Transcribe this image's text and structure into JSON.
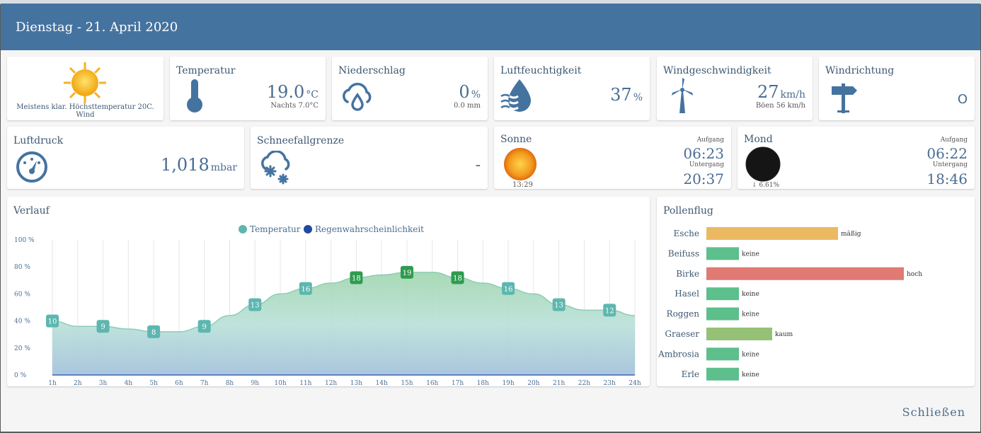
{
  "header": {
    "title": "Dienstag - 21. April 2020"
  },
  "summary": {
    "text": "Meistens klar. Höchsttemperatur 20C. Wind"
  },
  "temperature": {
    "title": "Temperatur",
    "value": "19.0",
    "unit": "°C",
    "night": "Nachts 7.0°C"
  },
  "precipitation": {
    "title": "Niederschlag",
    "value": "0",
    "unit": "%",
    "amount": "0.0 mm"
  },
  "humidity": {
    "title": "Luftfeuchtigkeit",
    "value": "37",
    "unit": "%"
  },
  "wind_speed": {
    "title": "Windgeschwindigkeit",
    "value": "27",
    "unit": "km/h",
    "gusts": "Böen 56 km/h"
  },
  "wind_direction": {
    "title": "Windrichtung",
    "value": "O"
  },
  "pressure": {
    "title": "Luftdruck",
    "value": "1,018",
    "unit": "mbar"
  },
  "snow_line": {
    "title": "Schneefallgrenze",
    "value": "-"
  },
  "sun": {
    "title": "Sonne",
    "rise_label": "Aufgang",
    "rise": "06:23",
    "set_label": "Untergang",
    "set": "20:37",
    "duration": "13:29"
  },
  "moon": {
    "title": "Mond",
    "rise_label": "Aufgang",
    "rise": "06:22",
    "set_label": "Untergang",
    "set": "18:46",
    "illumination": "6.61%"
  },
  "chart_section": {
    "title": "Verlauf"
  },
  "pollen_section": {
    "title": "Pollenflug"
  },
  "footer": {
    "close_label": "Schließen"
  },
  "colors": {
    "header": "#4573a0",
    "temp_area": "#8fc9c0",
    "rain_area": "#a8c6db",
    "green_label": "#2e9c4e",
    "teal_label": "#5db7b0",
    "pollen_moderate": "#ebb962",
    "pollen_none": "#5dbf8b",
    "pollen_high": "#e07a72",
    "pollen_low": "#95c177"
  },
  "chart_data": [
    {
      "type": "area",
      "title": "Verlauf",
      "x": [
        "1h",
        "2h",
        "3h",
        "4h",
        "5h",
        "6h",
        "7h",
        "8h",
        "9h",
        "10h",
        "11h",
        "12h",
        "13h",
        "14h",
        "15h",
        "16h",
        "17h",
        "18h",
        "19h",
        "20h",
        "21h",
        "22h",
        "23h",
        "24h"
      ],
      "y_ticks": [
        "100 %",
        "80 %",
        "60 %",
        "40 %",
        "20 %",
        "0 %"
      ],
      "ylim": [
        0,
        100
      ],
      "legend_position": "top-center",
      "series": [
        {
          "name": "Temperatur",
          "values": [
            10,
            9,
            9,
            8.5,
            8,
            8,
            9,
            11,
            13,
            15,
            16,
            17,
            18,
            18.5,
            19,
            19,
            18,
            17,
            16,
            15,
            13,
            12,
            12,
            11
          ],
          "labels": {
            "1h": "10",
            "3h": "9",
            "5h": "8",
            "7h": "9",
            "9h": "13",
            "11h": "16",
            "13h": "18",
            "15h": "19",
            "17h": "18",
            "19h": "16",
            "21h": "13",
            "23h": "12"
          }
        },
        {
          "name": "Regenwahrscheinlichkeit",
          "values": [
            0,
            0,
            0,
            0,
            0,
            0,
            0,
            0,
            0,
            0,
            0,
            0,
            0,
            0,
            0,
            0,
            0,
            0,
            0,
            0,
            0,
            0,
            0,
            0
          ]
        }
      ]
    },
    {
      "type": "bar",
      "title": "Pollenflug",
      "orientation": "horizontal",
      "categories": [
        "Esche",
        "Beifuss",
        "Birke",
        "Hasel",
        "Roggen",
        "Graeser",
        "Ambrosia",
        "Erle"
      ],
      "values": [
        2,
        0,
        3,
        0,
        0,
        1,
        0,
        0
      ],
      "value_labels": [
        "mäßig",
        "keine",
        "hoch",
        "keine",
        "keine",
        "kaum",
        "keine",
        "keine"
      ]
    }
  ]
}
